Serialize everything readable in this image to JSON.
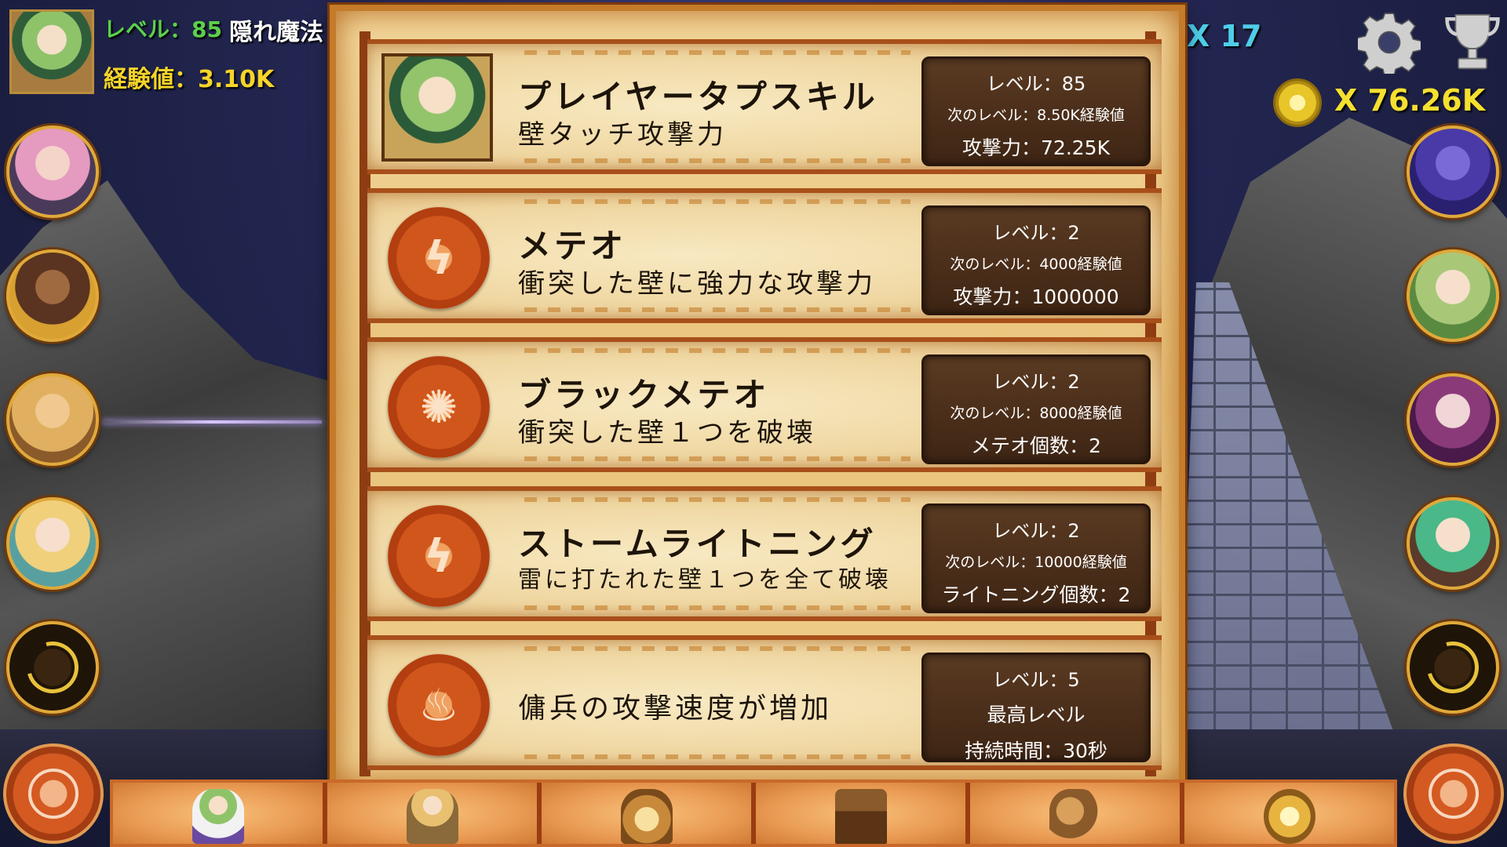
{
  "hud": {
    "level_label": "レベル：",
    "level_value": "85",
    "title_text": "隠れ魔法",
    "exp_label": "経験値：3.10K",
    "gem_count": "X 17",
    "coin_count": "X 76.26K"
  },
  "icons": {
    "settings": "gear-icon",
    "trophy": "trophy-icon",
    "coin": "coin-icon"
  },
  "skills": [
    {
      "name": "プレイヤータプスキル",
      "desc": "壁タッチ攻撃力",
      "level": "レベル：85",
      "next": "次のレベル：8.50K経験値",
      "stat": "攻撃力：72.25K",
      "icon": "player-portrait-icon"
    },
    {
      "name": "メテオ",
      "desc": "衝突した壁に強力な攻撃力",
      "level": "レベル：2",
      "next": "次のレベル：4000経験値",
      "stat": "攻撃力：1000000",
      "icon": "lightning-rune-icon"
    },
    {
      "name": "ブラックメテオ",
      "desc": "衝突した壁１つを破壊",
      "level": "レベル：2",
      "next": "次のレベル：8000経験値",
      "stat": "メテオ個数：2",
      "icon": "sun-rune-icon"
    },
    {
      "name": "ストームライトニング",
      "desc": "雷に打たれた壁１つを全て破壊",
      "level": "レベル：2",
      "next": "次のレベル：10000経験値",
      "stat": "ライトニング個数：2",
      "icon": "lightning-rune-icon"
    },
    {
      "name": "",
      "desc": "傭兵の攻撃速度が増加",
      "level": "レベル：5",
      "next": "最高レベル",
      "stat": "持続時間：30秒",
      "icon": "flame-rune-icon"
    }
  ],
  "colors": {
    "level_green": "#5bd14a",
    "exp_yellow": "#f5d42a",
    "gem_cyan": "#4ecde8",
    "coin_yellow": "#f5e030",
    "panel_border": "#c47b2a",
    "stats_bg": "#4a2e1a"
  }
}
